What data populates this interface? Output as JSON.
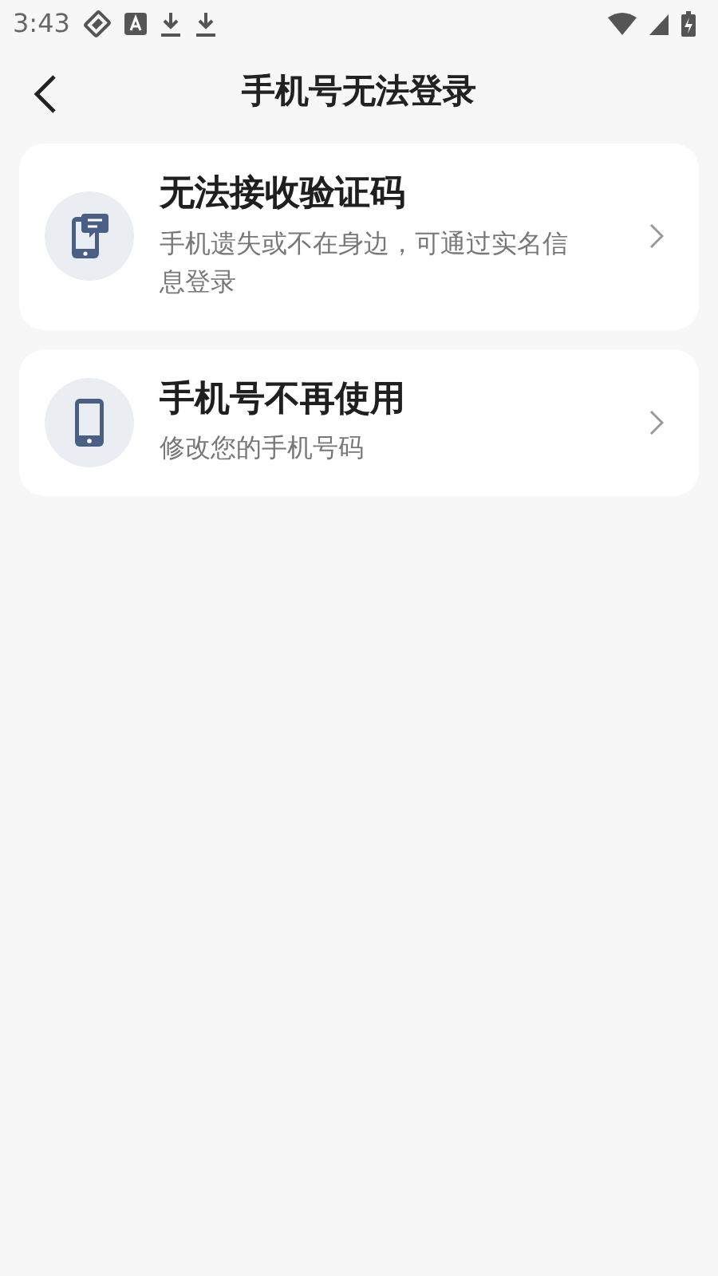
{
  "status_bar": {
    "time": "3:43"
  },
  "header": {
    "title": "手机号无法登录"
  },
  "options": [
    {
      "kind": "message-phone",
      "title": "无法接收验证码",
      "description": "手机遗失或不在身边，可通过实名信息登录"
    },
    {
      "kind": "phone",
      "title": "手机号不再使用",
      "description": "修改您的手机号码"
    }
  ]
}
